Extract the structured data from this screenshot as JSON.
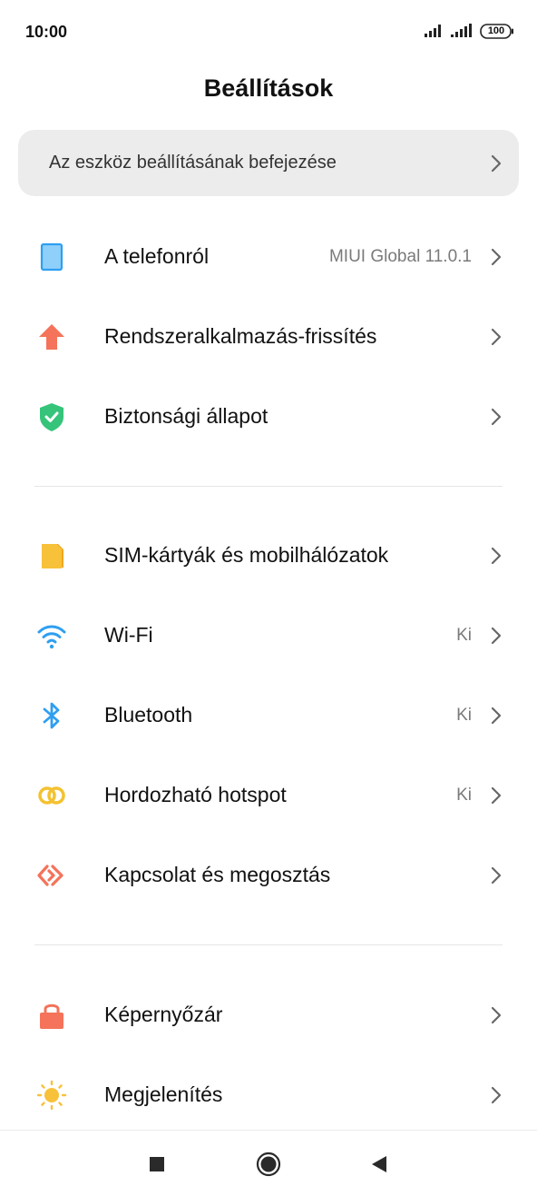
{
  "status_bar": {
    "time": "10:00",
    "battery": "100"
  },
  "header": {
    "title": "Beállítások"
  },
  "setup_card": {
    "label": "Az eszköz beállításának befejezése"
  },
  "sections": [
    {
      "items": [
        {
          "label": "A telefonról",
          "value": "MIUI Global 11.0.1",
          "icon": "phone-icon",
          "icon_color": "#3aa1ee"
        },
        {
          "label": "Rendszeralkalmazás-frissítés",
          "value": "",
          "icon": "arrow-up-icon",
          "icon_color": "#f4735a"
        },
        {
          "label": "Biztonsági állapot",
          "value": "",
          "icon": "shield-check-icon",
          "icon_color": "#35c47a"
        }
      ]
    },
    {
      "items": [
        {
          "label": "SIM-kártyák és mobilhálózatok",
          "value": "",
          "icon": "sim-card-icon",
          "icon_color": "#f8c13a"
        },
        {
          "label": "Wi-Fi",
          "value": "Ki",
          "icon": "wifi-icon",
          "icon_color": "#2f9ff0"
        },
        {
          "label": "Bluetooth",
          "value": "Ki",
          "icon": "bluetooth-icon",
          "icon_color": "#2f9ff0"
        },
        {
          "label": "Hordozható hotspot",
          "value": "Ki",
          "icon": "hotspot-icon",
          "icon_color": "#f4c230"
        },
        {
          "label": "Kapcsolat és megosztás",
          "value": "",
          "icon": "connection-share-icon",
          "icon_color": "#f4735a"
        }
      ]
    },
    {
      "items": [
        {
          "label": "Képernyőzár",
          "value": "",
          "icon": "lock-icon",
          "icon_color": "#f4735a"
        },
        {
          "label": "Megjelenítés",
          "value": "",
          "icon": "sun-icon",
          "icon_color": "#f8c13a"
        }
      ]
    }
  ]
}
